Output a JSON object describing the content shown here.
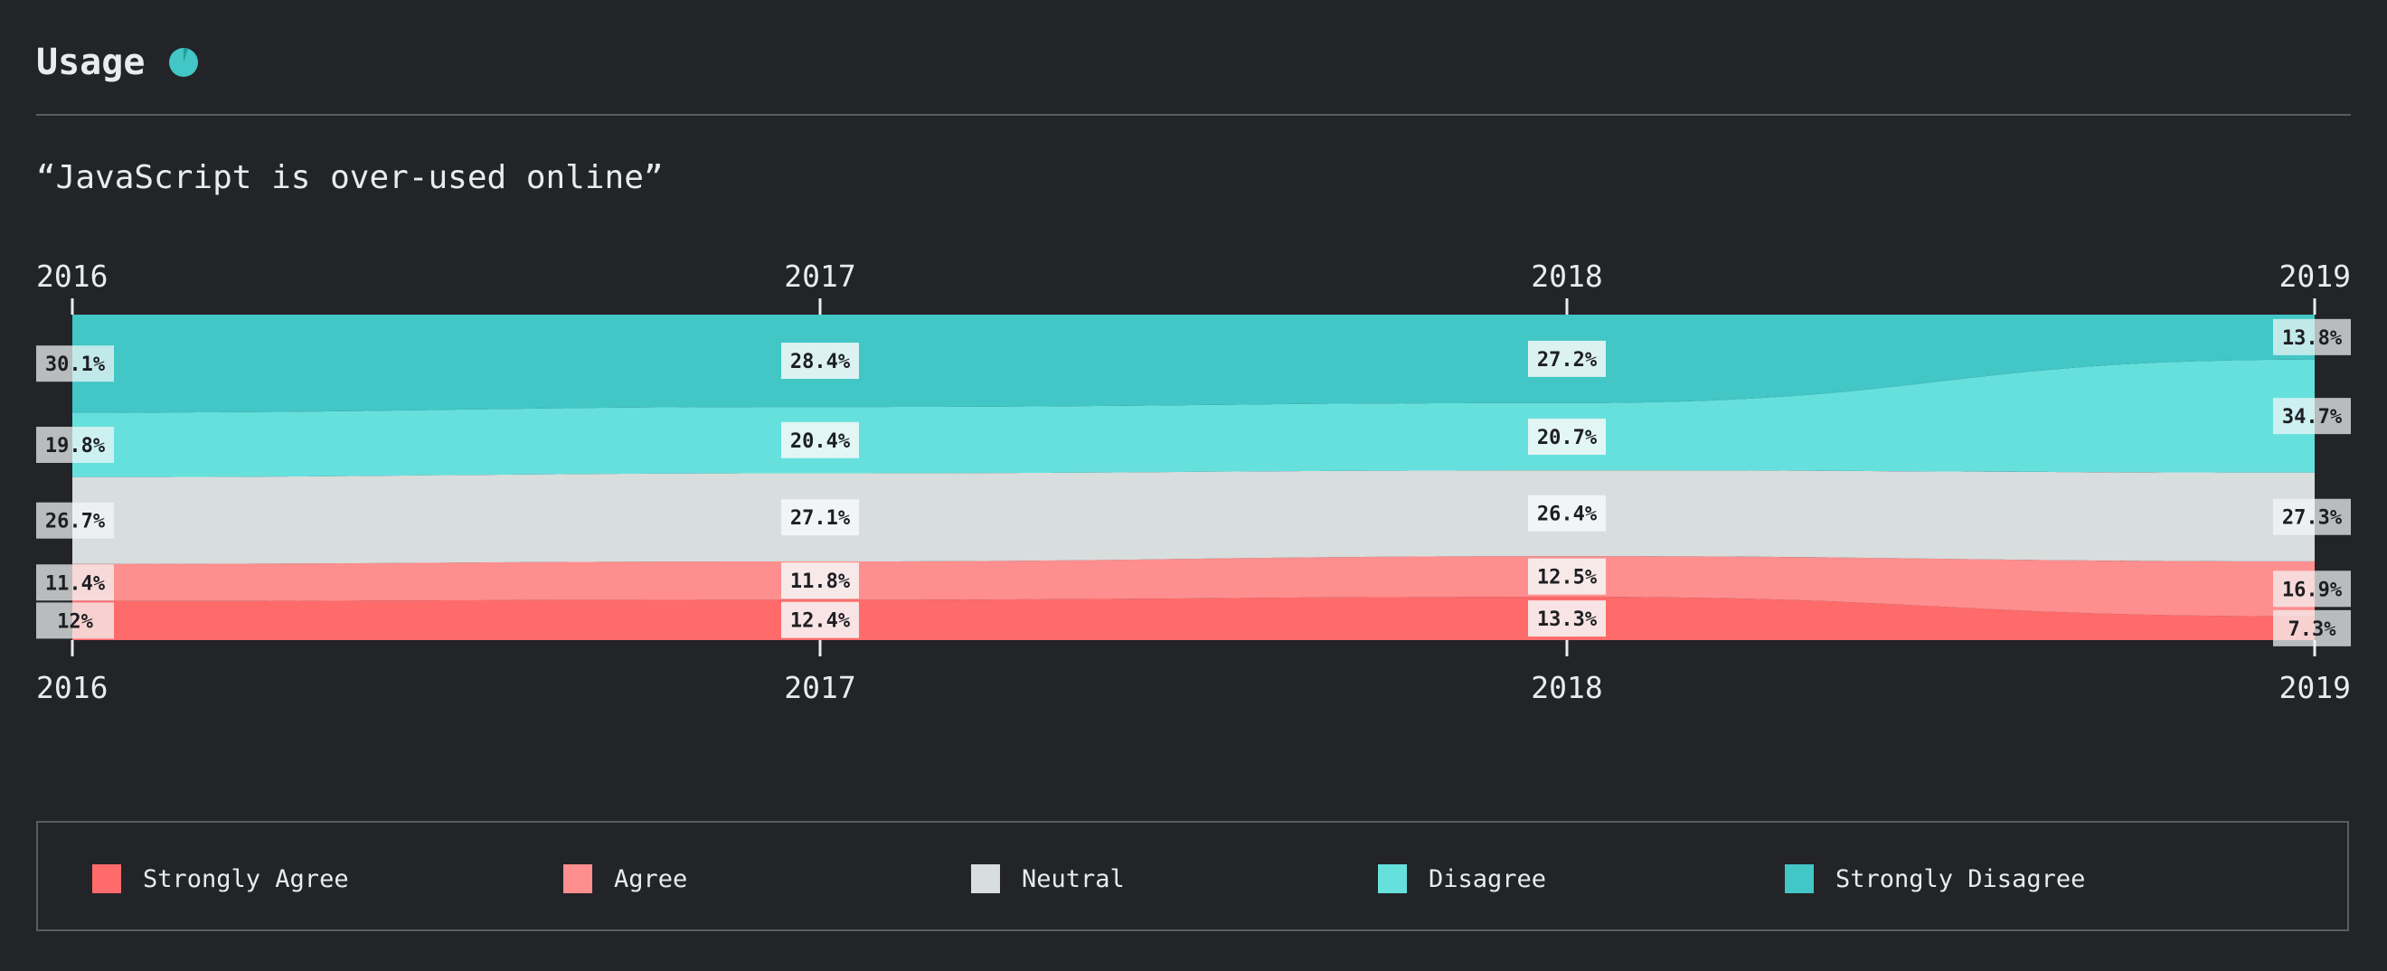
{
  "header": {
    "title": "Usage",
    "icon": "pie-chart-icon"
  },
  "question": "“JavaScript is over-used online”",
  "chart_data": {
    "type": "area",
    "x": [
      "2016",
      "2017",
      "2018",
      "2019"
    ],
    "stacked": "100%",
    "series": [
      {
        "name": "Strongly Agree",
        "color": "#ff6b6b",
        "values": [
          12,
          12.4,
          13.3,
          7.3
        ]
      },
      {
        "name": "Agree",
        "color": "#ff8e8e",
        "values": [
          11.4,
          11.8,
          12.5,
          16.9
        ]
      },
      {
        "name": "Neutral",
        "color": "#d8dddd",
        "values": [
          26.7,
          27.1,
          26.4,
          27.3
        ]
      },
      {
        "name": "Disagree",
        "color": "#66e0dd",
        "values": [
          19.8,
          20.4,
          20.7,
          34.7
        ]
      },
      {
        "name": "Strongly Disagree",
        "color": "#42c6c6",
        "values": [
          30.1,
          28.4,
          27.2,
          13.8
        ]
      }
    ],
    "labels": [
      [
        "12%",
        "12.4%",
        "13.3%",
        "7.3%"
      ],
      [
        "11.4%",
        "11.8%",
        "12.5%",
        "16.9%"
      ],
      [
        "26.7%",
        "27.1%",
        "26.4%",
        "27.3%"
      ],
      [
        "19.8%",
        "20.4%",
        "20.7%",
        "34.7%"
      ],
      [
        "30.1%",
        "28.4%",
        "27.2%",
        "13.8%"
      ]
    ],
    "ylim": [
      0,
      100
    ],
    "legend_position": "bottom"
  }
}
